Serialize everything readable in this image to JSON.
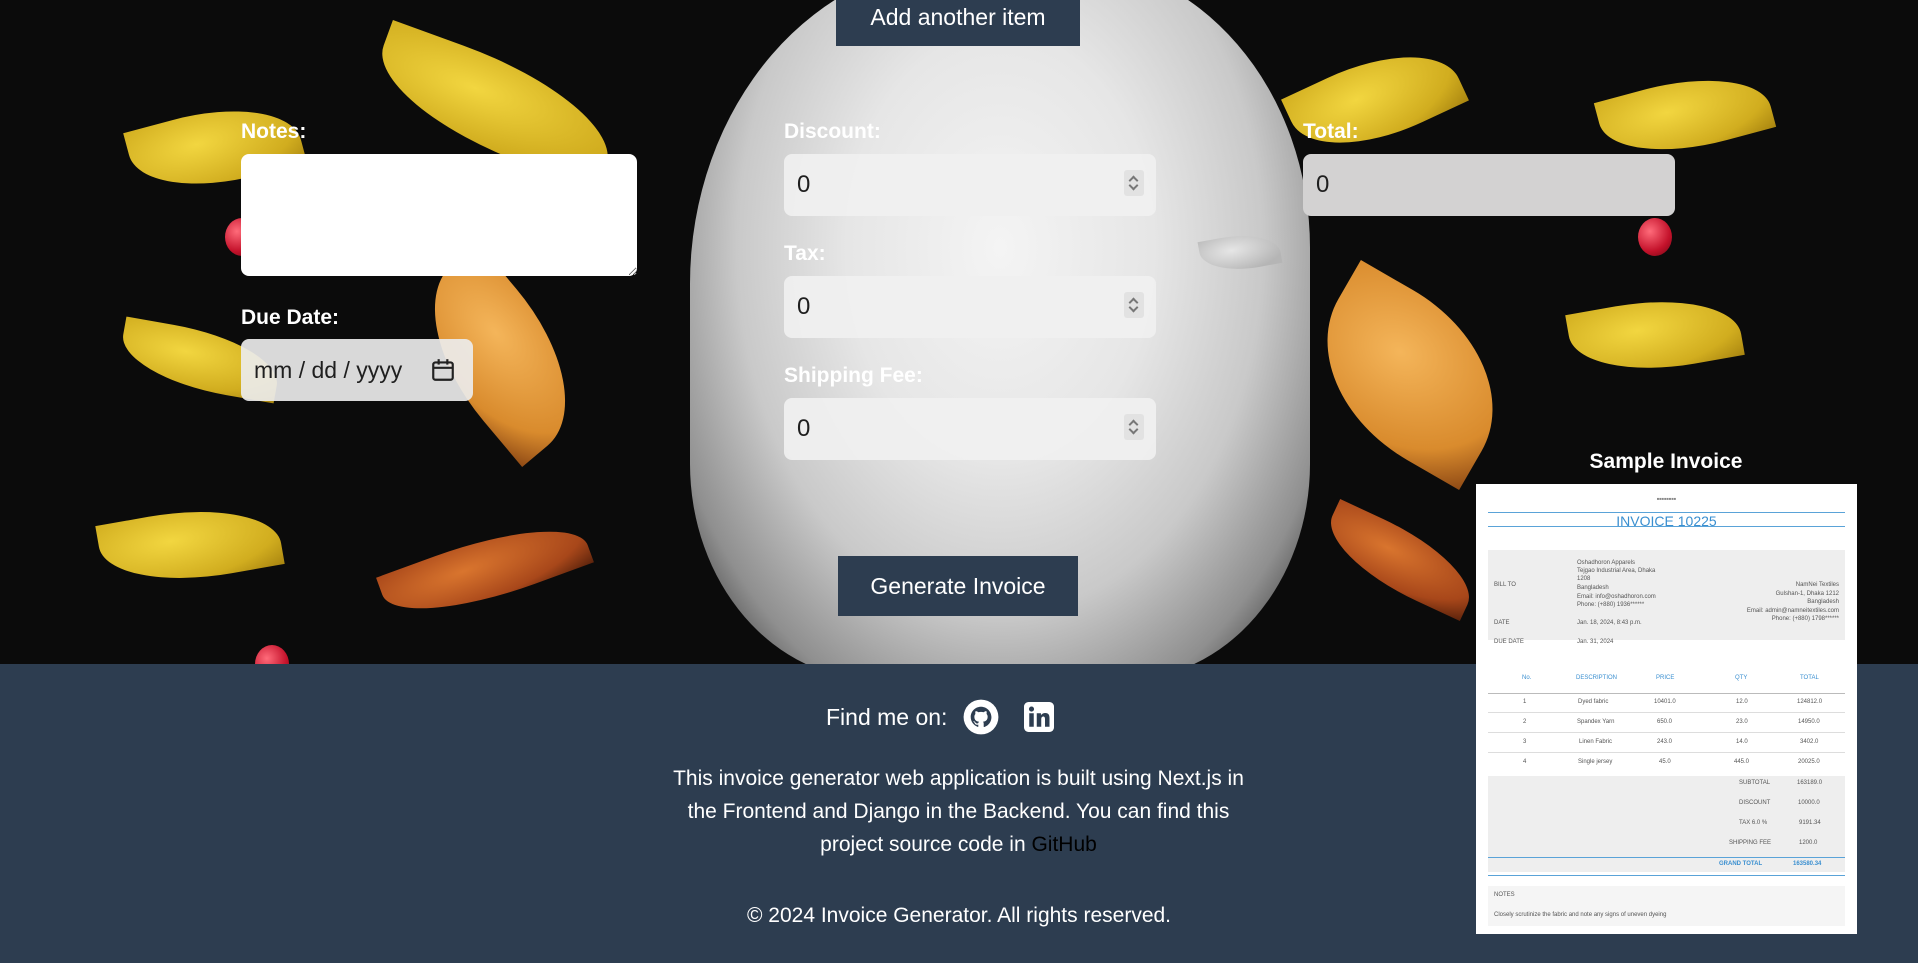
{
  "top_button": {
    "label": "Add another item"
  },
  "form": {
    "notes_label": "Notes:",
    "notes_value": "",
    "due_date_label": "Due Date:",
    "due_date_placeholder": "mm / dd / yyyy",
    "discount_label": "Discount:",
    "discount_value": "0",
    "tax_label": "Tax:",
    "tax_value": "0",
    "shipping_label": "Shipping Fee:",
    "shipping_value": "0",
    "total_label": "Total:",
    "total_value": "0",
    "generate_label": "Generate Invoice"
  },
  "sample": {
    "title": "Sample Invoice",
    "invoice_number": "INVOICE 10225",
    "bill_to_label": "BILL TO",
    "date_label": "DATE",
    "due_date_label": "DUE DATE",
    "from_lines": [
      "Oshadhoron Apparels",
      "Tejgao Industrial Area, Dhaka",
      "1208",
      "Bangladesh",
      "Email: info@oshadhoron.com",
      "Phone: (+880) 1936******"
    ],
    "to_lines": [
      "NamNei Textiles",
      "Gulshan-1, Dhaka 1212",
      "Bangladesh",
      "Email: admin@namneitextiles.com",
      "Phone: (+880) 1798******"
    ],
    "date_value": "Jan. 18, 2024, 8:43 p.m.",
    "due_value": "Jan. 31, 2024",
    "columns": [
      "No.",
      "DESCRIPTION",
      "PRICE",
      "QTY",
      "TOTAL"
    ],
    "rows": [
      [
        "1",
        "Dyed fabric",
        "10401.0",
        "12.0",
        "124812.0"
      ],
      [
        "2",
        "Spandex Yarn",
        "650.0",
        "23.0",
        "14950.0"
      ],
      [
        "3",
        "Linen Fabric",
        "243.0",
        "14.0",
        "3402.0"
      ],
      [
        "4",
        "Single jersey",
        "45.0",
        "445.0",
        "20025.0"
      ]
    ],
    "summary": [
      [
        "SUBTOTAL",
        "163189.0"
      ],
      [
        "DISCOUNT",
        "10000.0"
      ],
      [
        "TAX 6.0 %",
        "9191.34"
      ],
      [
        "SHIPPING FEE",
        "1200.0"
      ]
    ],
    "grand_total_label": "GRAND TOTAL",
    "grand_total_value": "163580.34",
    "notes_label": "NOTES",
    "notes_text": "Closely scrutinize the fabric and note any signs of uneven dyeing"
  },
  "footer": {
    "find_me": "Find me on:",
    "about_text": "This invoice generator web application is built using Next.js in the Frontend and Django in the Backend. You can find this project source code in ",
    "github_link": "GitHub",
    "copyright": "© 2024 Invoice Generator. All rights reserved.",
    "icons": [
      "github-icon",
      "linkedin-icon"
    ]
  }
}
